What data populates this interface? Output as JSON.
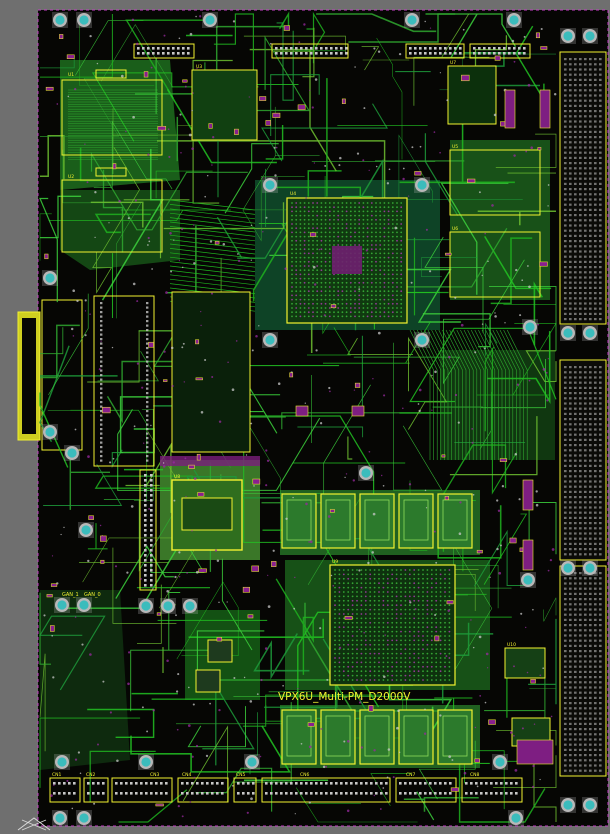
{
  "board": {
    "label": "VPX6U_Multi-PM_D2000V",
    "connector_labels": [
      "GAN_1",
      "GAN_0",
      "CN1",
      "CN2",
      "CN3",
      "CN4",
      "CN5",
      "CN6",
      "CN7",
      "CN8"
    ],
    "ic_labels": [
      "U1",
      "U2",
      "U3",
      "U4",
      "U5",
      "U6",
      "U7",
      "U8",
      "U9",
      "U10"
    ]
  },
  "colors": {
    "canvas": "#6f6f6f",
    "substrate": "#060604",
    "copper_top": "#1fb21f",
    "copper_fill": "#4fa63a",
    "silkscreen": "#f2f230",
    "via": "#8a1f8f",
    "mounting_hole": "#3bbcbc",
    "pad": "#c7c7c7"
  }
}
